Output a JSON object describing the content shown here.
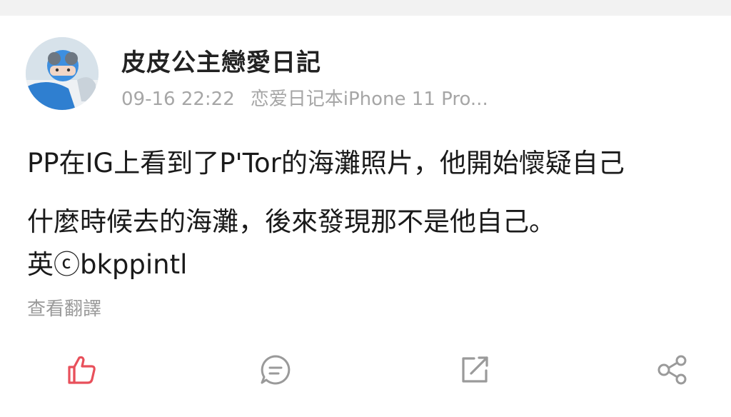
{
  "post": {
    "username": "皮皮公主戀愛日記",
    "timestamp": "09-16 22:22",
    "source": "恋爱日记本iPhone 11 Pro...",
    "text_lines": [
      "PP在IG上看到了P'Tor的海灘照片，他開始懷疑自己",
      "什麼時候去的海灘，後來發現那不是他自己。"
    ],
    "credit": "英ⓒbkppintl",
    "translate_link": "查看翻譯"
  },
  "actions": {
    "like_icon": "thumbs-up-icon",
    "comment_icon": "comment-bubble-icon",
    "repost_icon": "external-share-icon",
    "share_icon": "share-nodes-icon",
    "like_color": "#e8505b",
    "icon_color": "#9a9a9a"
  }
}
